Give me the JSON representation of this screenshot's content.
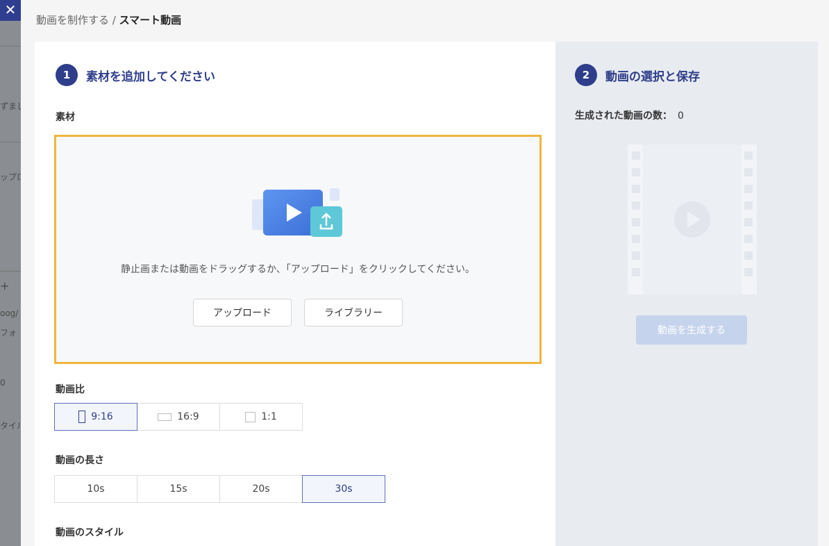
{
  "background": {
    "close_label": "✕",
    "fragments": [
      "ずまし",
      "ップロ",
      "+",
      "oog/",
      "フォ",
      "0",
      "タイル"
    ]
  },
  "breadcrumb": {
    "parent": "動画を制作する",
    "separator": " / ",
    "current": "スマート動画"
  },
  "step1": {
    "number": "1",
    "title": "素材を追加してください",
    "material_label": "素材",
    "dropzone": {
      "hint": "静止画または動画をドラッグするか、「アップロード」をクリックしてください。",
      "upload_button": "アップロード",
      "library_button": "ライブラリー"
    },
    "ratio": {
      "label": "動画比",
      "options": [
        {
          "label": "9:16",
          "icon": "portrait-ratio-icon",
          "active": true
        },
        {
          "label": "16:9",
          "icon": "landscape-ratio-icon",
          "active": false
        },
        {
          "label": "1:1",
          "icon": "square-ratio-icon",
          "active": false
        }
      ]
    },
    "duration": {
      "label": "動画の長さ",
      "options": [
        {
          "label": "10s",
          "active": false
        },
        {
          "label": "15s",
          "active": false
        },
        {
          "label": "20s",
          "active": false
        },
        {
          "label": "30s",
          "active": true
        }
      ]
    },
    "style_label": "動画のスタイル"
  },
  "step2": {
    "number": "2",
    "title": "動画の選択と保存",
    "count_label": "生成された動画の数：",
    "count_value": "0",
    "generate_button": "動画を生成する"
  },
  "colors": {
    "accent": "#2e3e8a",
    "dropzone_border": "#f0b53c",
    "disabled_button": "#c6d3ec"
  }
}
